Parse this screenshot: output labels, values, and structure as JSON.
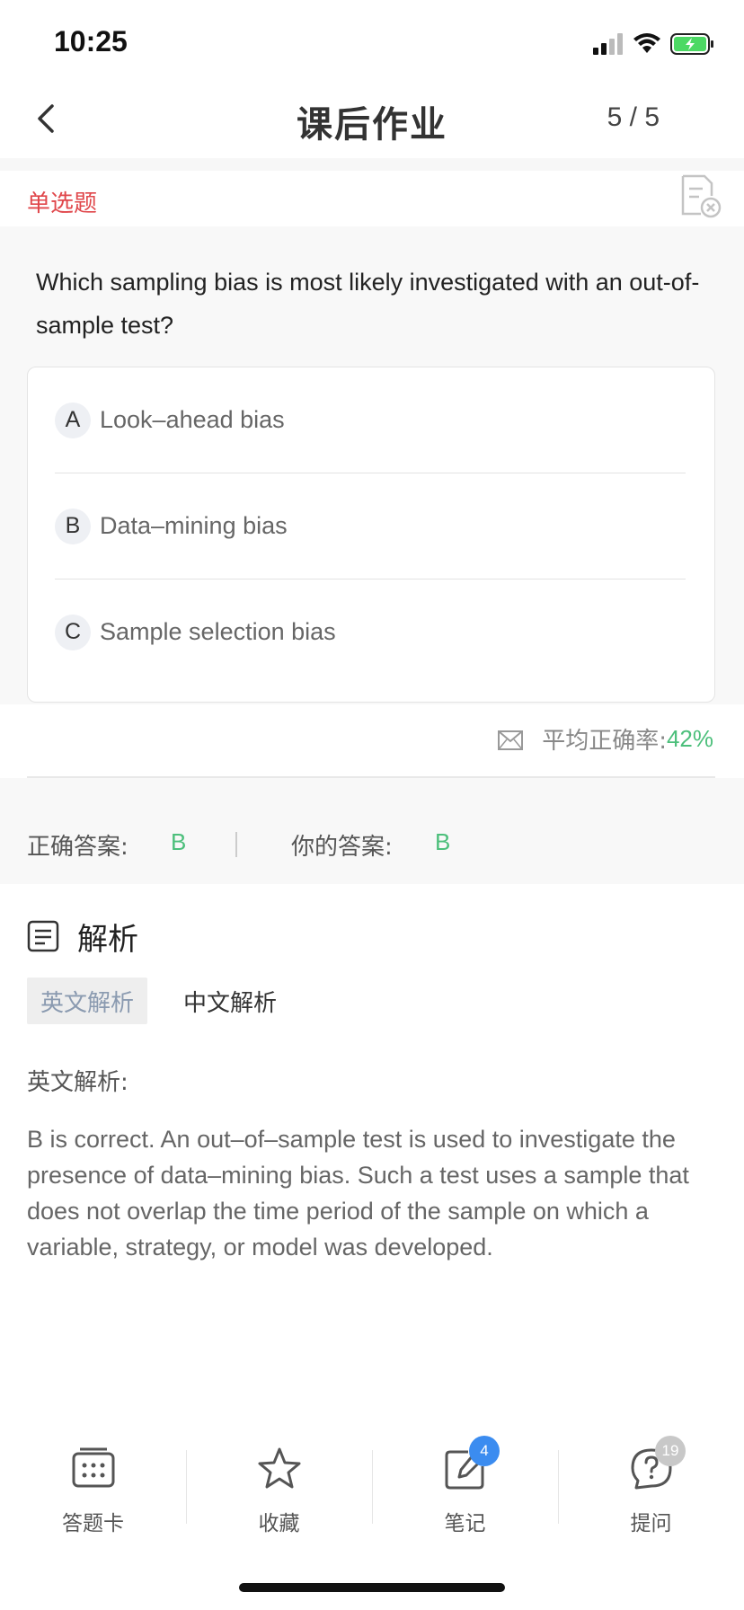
{
  "status_bar": {
    "time": "10:25"
  },
  "nav": {
    "title": "课后作业",
    "progress": "5 / 5"
  },
  "question": {
    "type_label": "单选题",
    "text": "Which sampling bias is most likely investigated with an out-of-sample test?",
    "options": [
      {
        "letter": "A",
        "text": "Look–ahead bias"
      },
      {
        "letter": "B",
        "text": "Data–mining bias"
      },
      {
        "letter": "C",
        "text": "Sample selection bias"
      }
    ]
  },
  "accuracy": {
    "label": "平均正确率:",
    "value": "42%"
  },
  "answers": {
    "correct_label": "正确答案:",
    "correct_value": "B",
    "yours_label": "你的答案:",
    "yours_value": "B"
  },
  "analysis": {
    "title": "解析",
    "tabs": [
      "英文解析",
      "中文解析"
    ],
    "subtitle": "英文解析:",
    "body": "B is correct. An out–of–sample test is used to investigate the presence of data–mining bias. Such a test uses a sample that does not overlap the time period of the sample on which a variable, strategy, or model was developed."
  },
  "bottom_bar": {
    "items": [
      {
        "label": "答题卡",
        "icon": "answer-card-icon"
      },
      {
        "label": "收藏",
        "icon": "star-icon"
      },
      {
        "label": "笔记",
        "icon": "note-edit-icon",
        "badge": "4"
      },
      {
        "label": "提问",
        "icon": "question-icon",
        "badge": "19"
      }
    ]
  },
  "colors": {
    "accent_red": "#e0474b",
    "accent_green": "#4cbf7b",
    "badge_blue": "#3b8cf0",
    "badge_gray": "#c8c8c8"
  }
}
